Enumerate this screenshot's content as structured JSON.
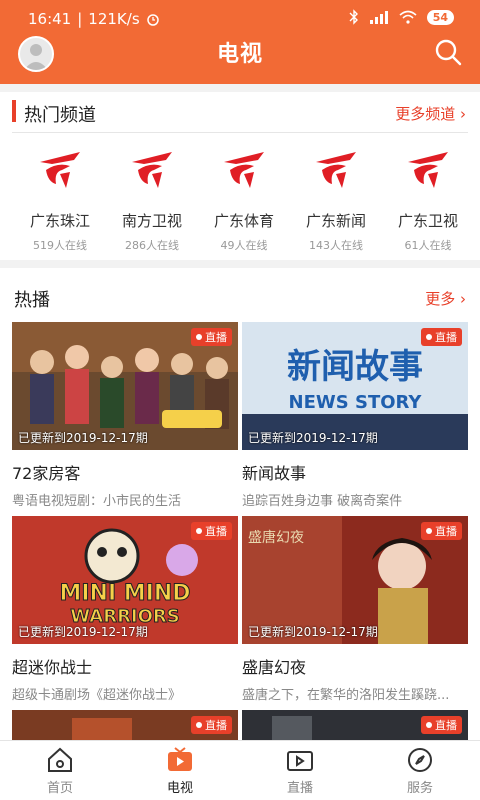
{
  "status_bar": {
    "time": "16:41",
    "speed": "121K/s",
    "battery": "54"
  },
  "header": {
    "title": "电视"
  },
  "hot_channels": {
    "title": "热门频道",
    "more_label": "更多频道",
    "items": [
      {
        "name": "广东珠江",
        "online": "519人在线"
      },
      {
        "name": "南方卫视",
        "online": "286人在线"
      },
      {
        "name": "广东体育",
        "online": "49人在线"
      },
      {
        "name": "广东新闻",
        "online": "143人在线"
      },
      {
        "name": "广东卫视",
        "online": "61人在线"
      }
    ]
  },
  "hot_play": {
    "title": "热播",
    "more_label": "更多",
    "live_label": "直播",
    "items": [
      {
        "title": "72家房客",
        "desc": "粤语电视短剧：小市民的生活",
        "updated": "已更新到2019-12-17期",
        "thumb_text": ""
      },
      {
        "title": "新闻故事",
        "desc": "追踪百姓身边事 破离奇案件",
        "updated": "已更新到2019-12-17期",
        "thumb_text": "新闻故事",
        "thumb_subtext": "NEWS STORY"
      },
      {
        "title": "超迷你战士",
        "desc": "超级卡通剧场《超迷你战士》",
        "updated": "已更新到2019-12-17期",
        "thumb_text": "MINI MIND",
        "thumb_subtext": "WARRIORS"
      },
      {
        "title": "盛唐幻夜",
        "desc": "盛唐之下，在繁华的洛阳发生蹊跷...",
        "updated": "已更新到2019-12-17期",
        "thumb_text": "盛唐幻夜"
      },
      {
        "title": "",
        "desc": "",
        "updated": ""
      },
      {
        "title": "",
        "desc": "",
        "updated": ""
      }
    ]
  },
  "tabbar": {
    "items": [
      {
        "label": "首页",
        "icon": "home-icon"
      },
      {
        "label": "电视",
        "icon": "tv-play-icon",
        "active": true
      },
      {
        "label": "直播",
        "icon": "live-video-icon"
      },
      {
        "label": "服务",
        "icon": "compass-icon"
      }
    ]
  },
  "colors": {
    "brand": "#f26a35",
    "accent": "#e8402a"
  }
}
